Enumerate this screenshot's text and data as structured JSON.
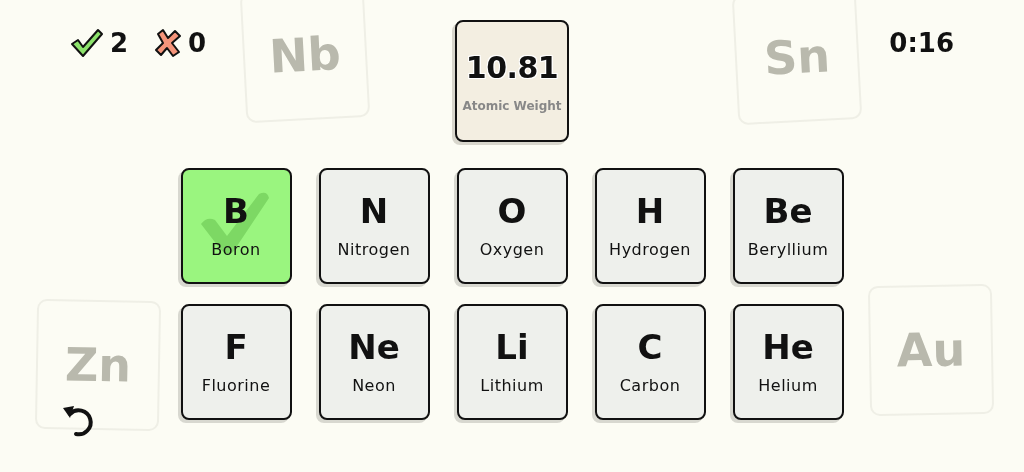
{
  "score": {
    "correct": "2",
    "wrong": "0"
  },
  "timer": "0:16",
  "clue": {
    "value": "10.81",
    "label": "Atomic Weight"
  },
  "tiles": [
    {
      "symbol": "B",
      "name": "Boron",
      "selected": true
    },
    {
      "symbol": "N",
      "name": "Nitrogen",
      "selected": false
    },
    {
      "symbol": "O",
      "name": "Oxygen",
      "selected": false
    },
    {
      "symbol": "H",
      "name": "Hydrogen",
      "selected": false
    },
    {
      "symbol": "Be",
      "name": "Beryllium",
      "selected": false
    },
    {
      "symbol": "F",
      "name": "Fluorine",
      "selected": false
    },
    {
      "symbol": "Ne",
      "name": "Neon",
      "selected": false
    },
    {
      "symbol": "Li",
      "name": "Lithium",
      "selected": false
    },
    {
      "symbol": "C",
      "name": "Carbon",
      "selected": false
    },
    {
      "symbol": "He",
      "name": "Helium",
      "selected": false
    }
  ],
  "background_tiles": [
    {
      "symbol": "Nb"
    },
    {
      "symbol": "Sn"
    },
    {
      "symbol": "Zn"
    },
    {
      "symbol": "Au"
    }
  ]
}
